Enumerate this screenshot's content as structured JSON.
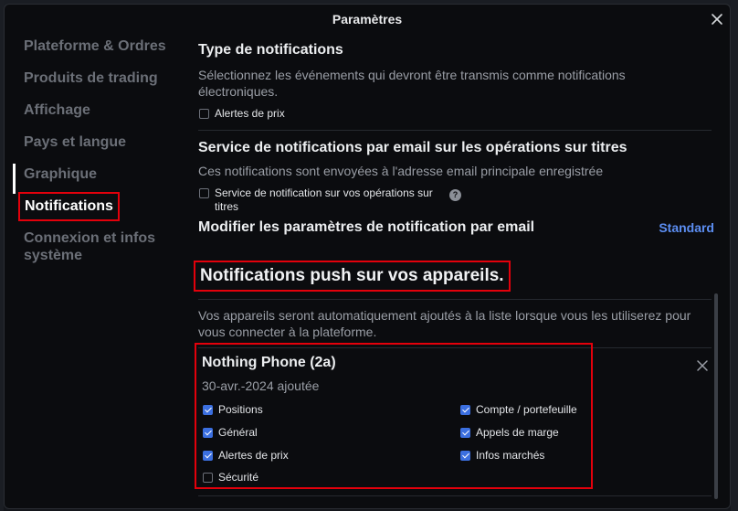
{
  "dialog": {
    "title": "Paramètres"
  },
  "sidebar": {
    "items": [
      {
        "label": "Plateforme & Ordres"
      },
      {
        "label": "Produits de trading"
      },
      {
        "label": "Affichage"
      },
      {
        "label": "Pays et langue"
      },
      {
        "label": "Graphique"
      },
      {
        "label": "Notifications",
        "active": true
      },
      {
        "label": "Connexion et infos système"
      }
    ]
  },
  "notif_type": {
    "title": "Type de notifications",
    "description": "Sélectionnez les événements qui devront être transmis comme notifications électroniques.",
    "price_alerts_label": "Alertes de prix",
    "price_alerts_checked": false
  },
  "email_service": {
    "title": "Service de notifications par email sur les opérations sur titres",
    "description": "Ces notifications sont envoyées à l'adresse email principale enregistrée",
    "checkbox_label": "Service de notification sur vos opérations sur titres",
    "checkbox_checked": false,
    "help_glyph": "?"
  },
  "email_settings": {
    "title": "Modifier les paramètres de notification par email",
    "link": "Standard"
  },
  "push": {
    "title": "Notifications push sur vos appareils.",
    "description": "Vos appareils seront automatiquement ajoutés à la liste lorsque vous les utiliserez pour vous connecter à la plateforme."
  },
  "device": {
    "name": "Nothing Phone (2a)",
    "added": "30-avr.-2024 ajoutée",
    "options_left": [
      {
        "label": "Positions",
        "checked": true
      },
      {
        "label": "Général",
        "checked": true
      },
      {
        "label": "Alertes de prix",
        "checked": true
      },
      {
        "label": "Sécurité",
        "checked": false
      }
    ],
    "options_right": [
      {
        "label": "Compte / portefeuille",
        "checked": true
      },
      {
        "label": "Appels de marge",
        "checked": true
      },
      {
        "label": "Infos marchés",
        "checked": true
      }
    ]
  },
  "colors": {
    "accent": "#3b6fe0",
    "link": "#5c8ef2",
    "highlight": "#e3000b"
  }
}
